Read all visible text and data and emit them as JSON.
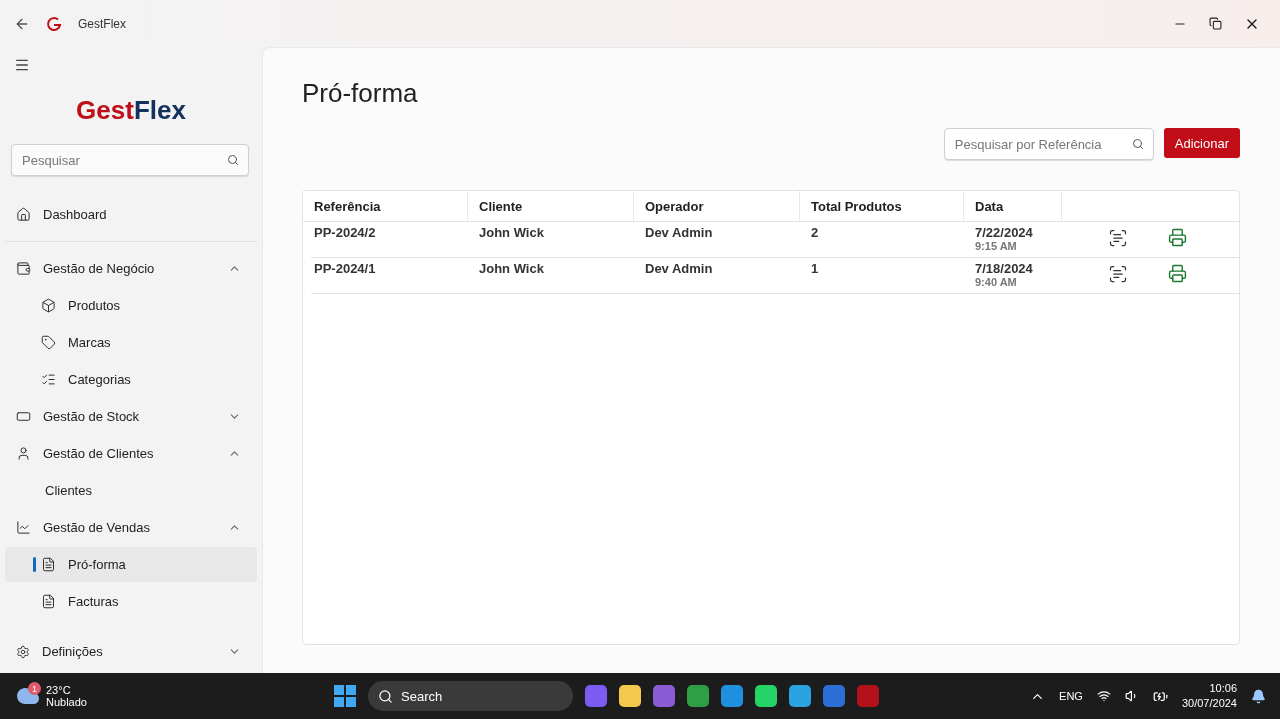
{
  "window": {
    "title": "GestFlex"
  },
  "sidebar": {
    "logo": {
      "first": "Gest",
      "second": "Flex"
    },
    "search": {
      "placeholder": "Pesquisar"
    },
    "items": [
      {
        "kind": "link",
        "label": "Dashboard",
        "selected": false
      },
      {
        "kind": "group",
        "label": "Gestão de Negócio",
        "expanded": true,
        "children": [
          {
            "label": "Produtos",
            "selected": false
          },
          {
            "label": "Marcas",
            "selected": false
          },
          {
            "label": "Categorias",
            "selected": false
          }
        ]
      },
      {
        "kind": "group",
        "label": "Gestão de Stock",
        "expanded": false
      },
      {
        "kind": "group",
        "label": "Gestão de Clientes",
        "expanded": true,
        "children": [
          {
            "label": "Clientes",
            "selected": false
          }
        ]
      },
      {
        "kind": "group",
        "label": "Gestão de Vendas",
        "expanded": true,
        "children": [
          {
            "label": "Pró-forma",
            "selected": true
          },
          {
            "label": "Facturas",
            "selected": false
          }
        ]
      }
    ],
    "footer": {
      "label": "Definições",
      "expanded": false
    }
  },
  "page": {
    "title": "Pró-forma",
    "search": {
      "placeholder": "Pesquisar por Referência"
    },
    "add_button": "Adicionar"
  },
  "table": {
    "columns": [
      "Referência",
      "Cliente",
      "Operador",
      "Total Produtos",
      "Data"
    ],
    "rows": [
      {
        "reference": "PP-2024/2",
        "client": "John Wick",
        "operator": "Dev Admin",
        "total": "2",
        "date": "7/22/2024",
        "time": "9:15 AM"
      },
      {
        "reference": "PP-2024/1",
        "client": "John Wick",
        "operator": "Dev Admin",
        "total": "1",
        "date": "7/18/2024",
        "time": "9:40 AM"
      }
    ]
  },
  "taskbar": {
    "weather": {
      "badge": "1",
      "temperature": "23°C",
      "condition": "Nublado"
    },
    "search": "Search",
    "language": "ENG",
    "time": "10:06",
    "date": "30/07/2024"
  }
}
